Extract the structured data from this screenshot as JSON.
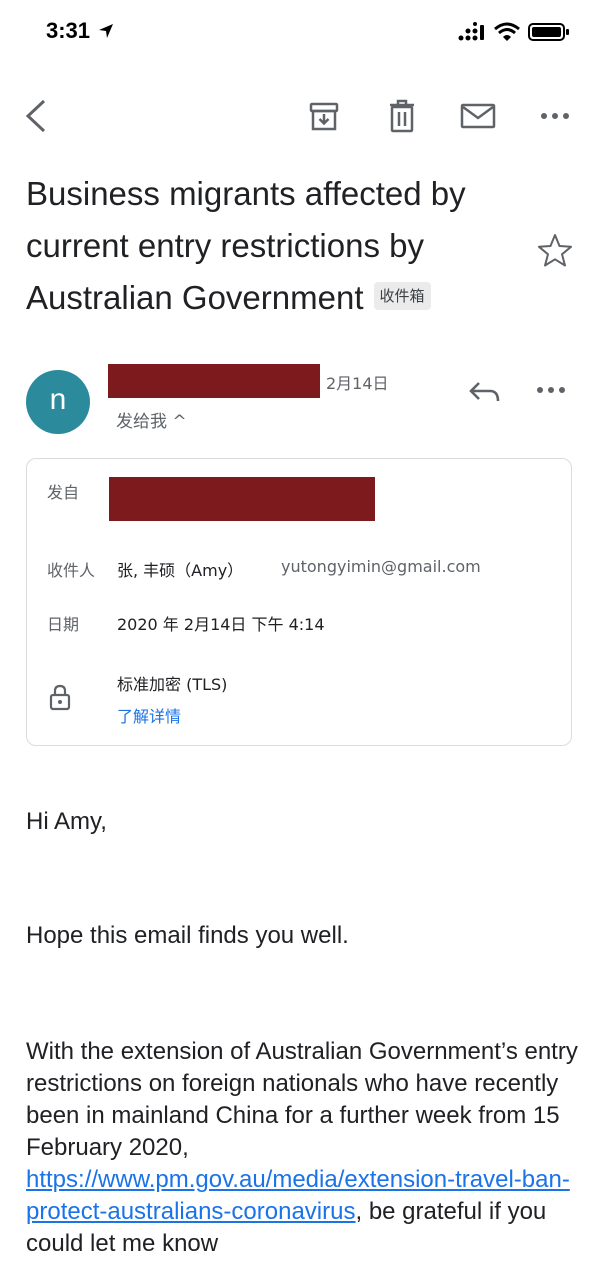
{
  "status_bar": {
    "time": "3:31",
    "icons": [
      "location-arrow-icon",
      "signal-icon",
      "wifi-icon",
      "battery-icon"
    ]
  },
  "toolbar": {
    "icons": [
      "back-icon",
      "archive-icon",
      "delete-icon",
      "mark-unread-icon",
      "more-icon"
    ]
  },
  "email": {
    "subject": "Business migrants affected by current entry restrictions by Australian Government",
    "label": "收件箱",
    "sender_initial": "n",
    "date_short": "2月14日",
    "to_line": "发给我 ^",
    "details": {
      "from_label": "发自",
      "to_label": "收件人",
      "to_name": "张, 丰硕（Amy）",
      "to_email": "yutongyimin@gmail.com",
      "date_label": "日期",
      "date_value": "2020 年 2月14日 下午 4:14",
      "security": "标准加密 (TLS)",
      "learn_more": "了解详情"
    },
    "body": {
      "greeting": "Hi Amy,",
      "line1": "Hope this email finds you well.",
      "para_start": "With the extension of Australian Government’s entry restrictions on foreign nationals who have recently been in mainland China for a further week from 15 February 2020,",
      "link": "https://www.pm.gov.au/media/extension-travel-ban-protect-australians-coronavirus",
      "para_end": ", be grateful if you could let me know"
    }
  },
  "colors": {
    "avatar": "#2b8a9b",
    "redaction": "#7c1a1e",
    "link": "#1a73e8"
  }
}
